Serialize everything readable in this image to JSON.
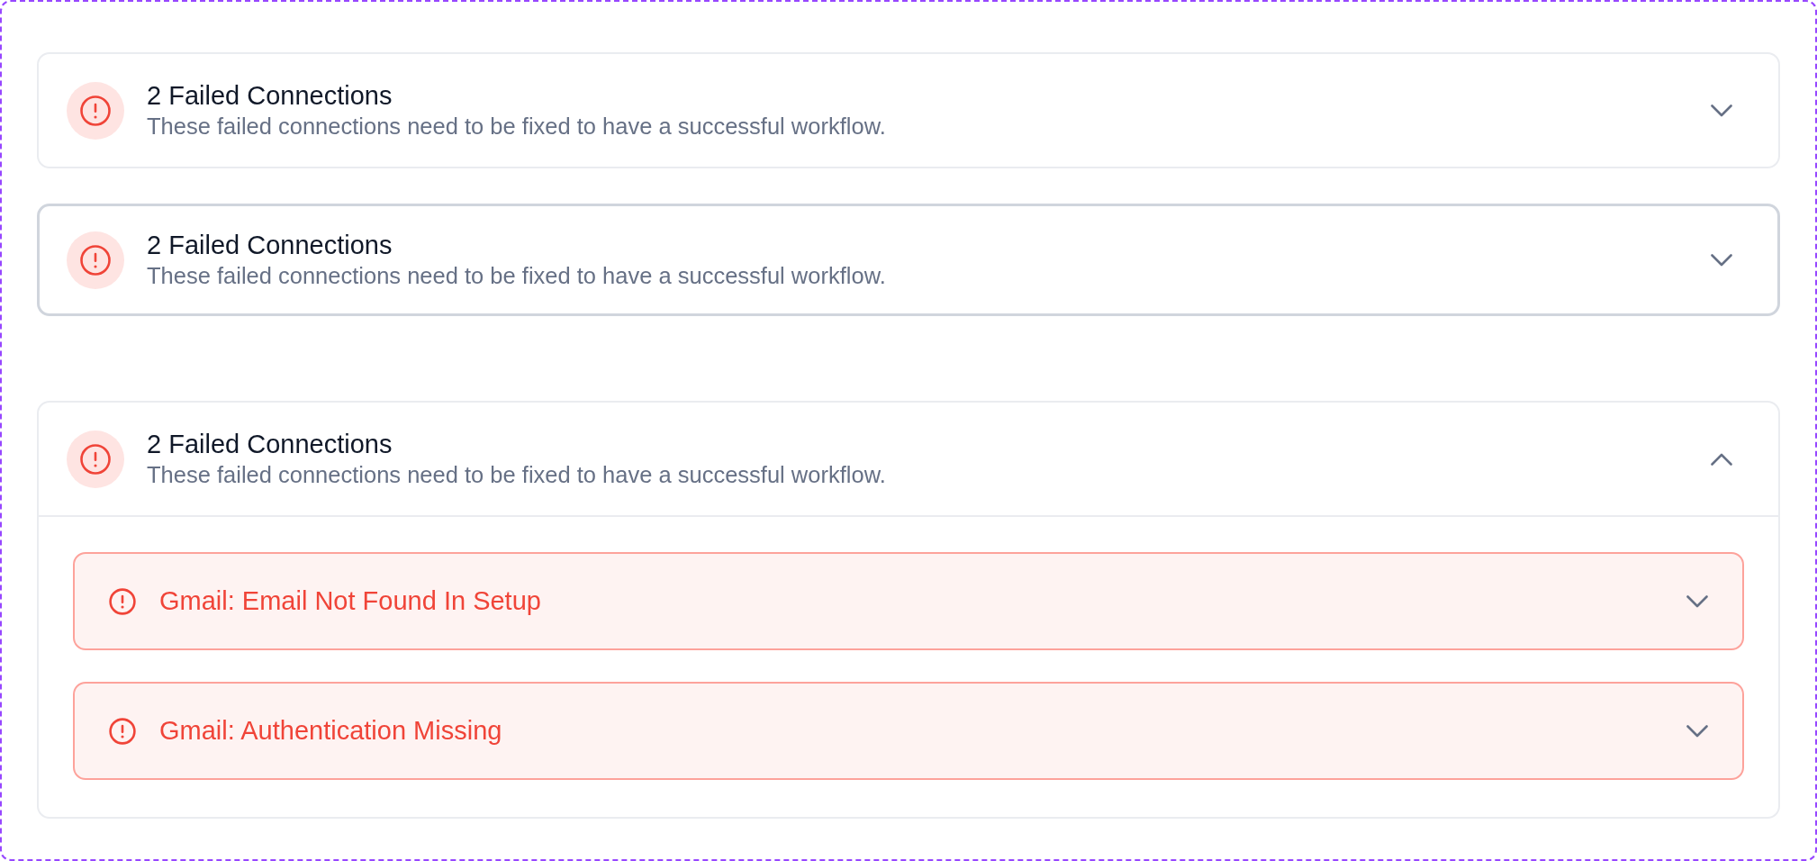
{
  "cards": [
    {
      "title": "2 Failed Connections",
      "description": "These failed connections need to be fixed to have a successful workflow.",
      "expanded": false,
      "focused": false
    },
    {
      "title": "2 Failed Connections",
      "description": "These failed connections need to be fixed to have a successful workflow.",
      "expanded": false,
      "focused": true
    },
    {
      "title": "2 Failed Connections",
      "description": "These failed connections need to be fixed to have a successful workflow.",
      "expanded": true,
      "focused": false,
      "items": [
        {
          "label": "Gmail: Email Not Found In Setup",
          "expanded": false
        },
        {
          "label": "Gmail: Authentication Missing",
          "expanded": false
        }
      ]
    }
  ]
}
